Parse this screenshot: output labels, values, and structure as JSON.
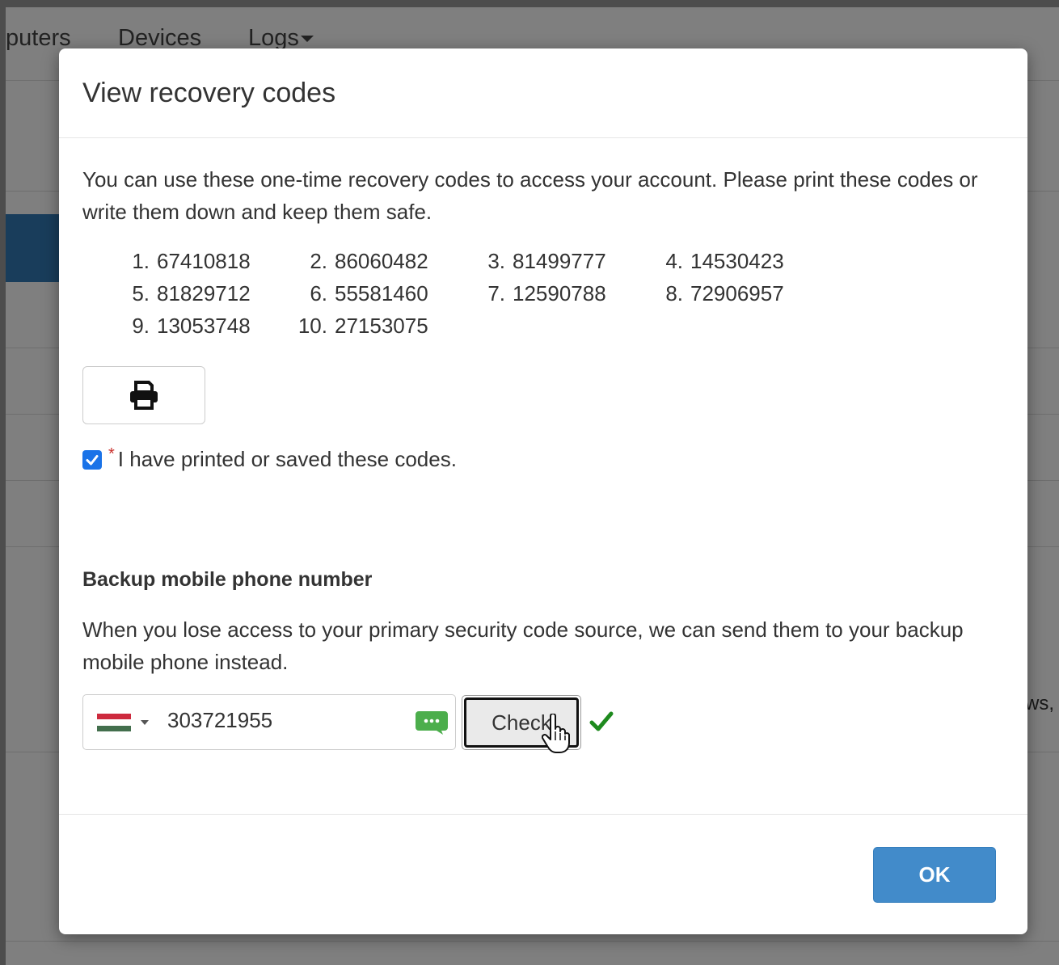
{
  "background": {
    "nav": {
      "computers": "puters",
      "devices": "Devices",
      "logs": "Logs"
    },
    "side_text": "ws,"
  },
  "modal": {
    "title": "View recovery codes",
    "intro": "You can use these one-time recovery codes to access your account. Please print these codes or write them down and keep them safe.",
    "codes": [
      {
        "num": "1.",
        "value": "67410818"
      },
      {
        "num": "2.",
        "value": "86060482"
      },
      {
        "num": "3.",
        "value": "81499777"
      },
      {
        "num": "4.",
        "value": "14530423"
      },
      {
        "num": "5.",
        "value": "81829712"
      },
      {
        "num": "6.",
        "value": "55581460"
      },
      {
        "num": "7.",
        "value": "12590788"
      },
      {
        "num": "8.",
        "value": "72906957"
      },
      {
        "num": "9.",
        "value": "13053748"
      },
      {
        "num": "10.",
        "value": "27153075"
      }
    ],
    "print_icon": "print-icon",
    "confirm": {
      "checked": true,
      "required_marker": "*",
      "label": "I have printed or saved these codes."
    },
    "backup": {
      "heading": "Backup mobile phone number",
      "description": "When you lose access to your primary security code source, we can send them to your backup mobile phone instead.",
      "country_flag": "hungary-flag-icon",
      "phone_value": "303721955",
      "sms_icon": "sms-icon",
      "check_label": "Check",
      "status_icon": "checkmark-icon"
    },
    "ok_label": "OK"
  },
  "colors": {
    "primary": "#428bca",
    "check_green": "#1e8a1e",
    "sms_green": "#4cae4c",
    "required_red": "#c9302c",
    "checkbox_blue": "#1a73e8",
    "flag_red": "#cd2a3e",
    "flag_white": "#ffffff",
    "flag_green": "#436f4d"
  }
}
